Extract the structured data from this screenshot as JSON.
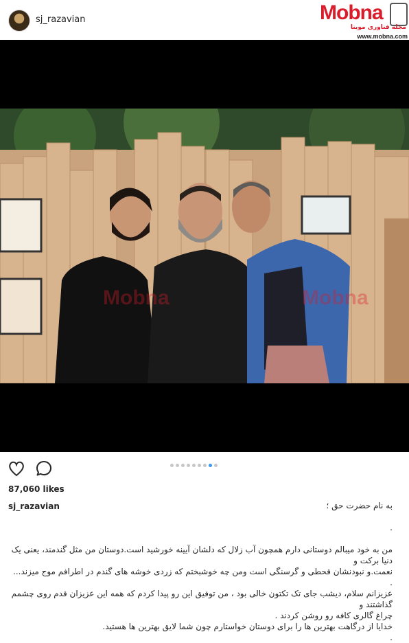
{
  "header": {
    "username": "sj_razavian",
    "logo": {
      "name": "Mobna",
      "tagline": "مجله فناوری موبنا",
      "url": "www.mobna.com"
    }
  },
  "media": {
    "carousel_total": 9,
    "carousel_active": 8
  },
  "actions": {
    "like_icon": "heart-icon",
    "comment_icon": "comment-icon"
  },
  "likes_text": "87,060 likes",
  "caption": {
    "username": "sj_razavian",
    "lines": [
      "به نام حضرت حق ؛",
      ".",
      "من به خود میبالم دوستانی دارم همچون آب زلال که دلشان آیینه خورشید است.دوستان من مثل گندمند، یعنی یک دنیا برکت و",
      "نعمت.و نبودنشان قحطی و گرسنگی است ومن چه خوشبختم که زردی خوشه های گندم در اطرافم موج میزند...",
      ".",
      "عزیزانم سلام، دیشب جای تک تکتون خالی بود ، من توفیق این رو پیدا کردم که همه این عزیزان قدم روی چشمم گذاشتند و",
      "چراغ گالری کافه رو روشن کردند .",
      "خدایا از درگاهت بهترین ها را برای دوستان خواستارم چون شما لایق بهترین ها هستید.",
      "."
    ]
  }
}
